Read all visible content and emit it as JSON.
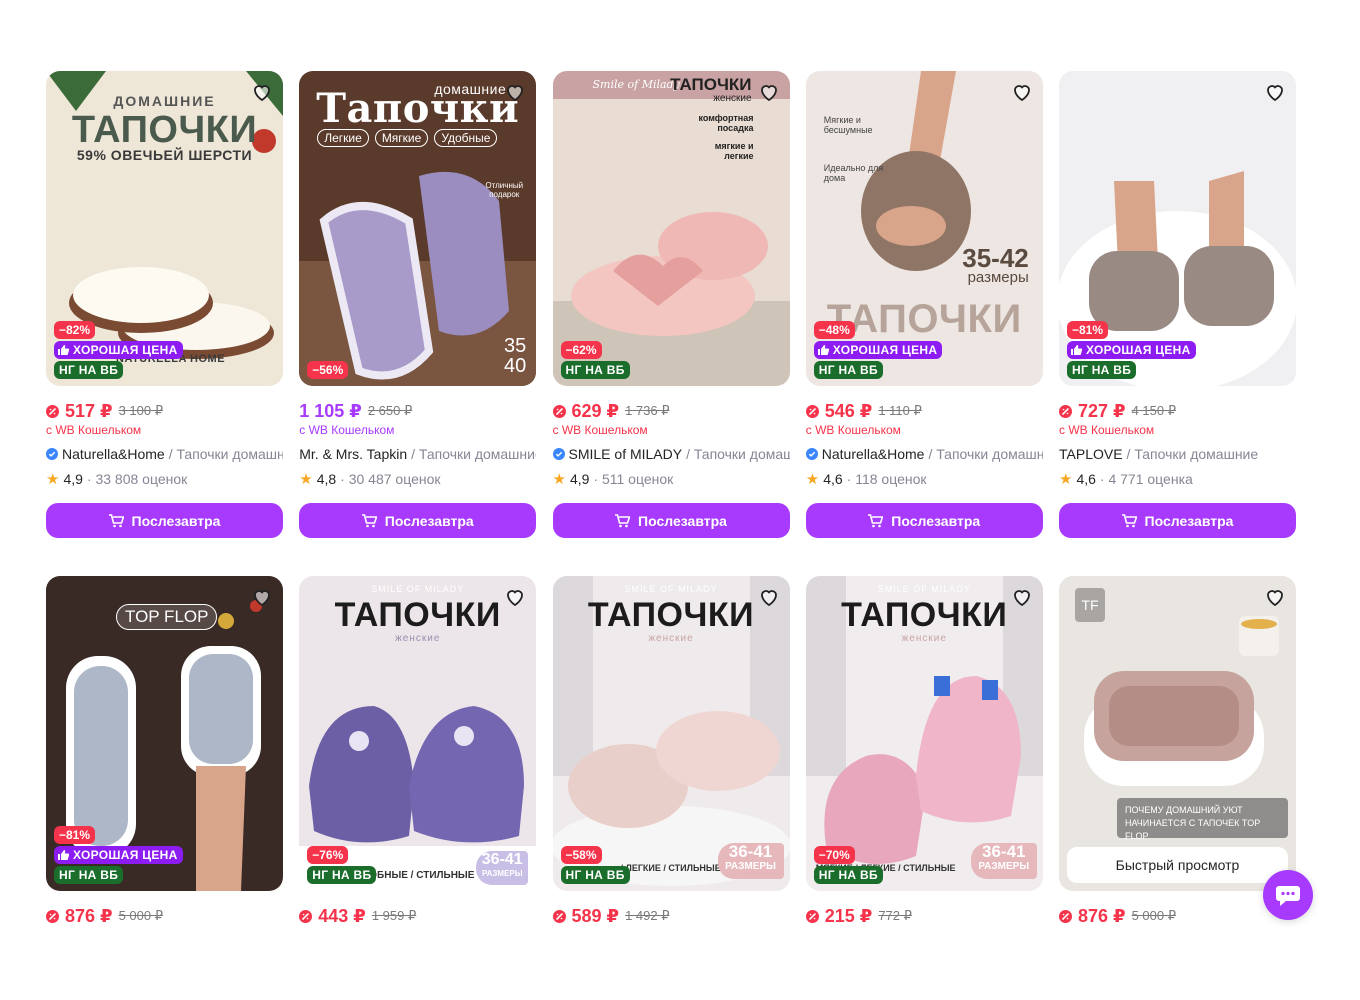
{
  "colors": {
    "accent": "#a73afd",
    "sale": "#f5334a",
    "good_price": "#8d1cf2",
    "ng_badge": "#1a6d2a"
  },
  "products": [
    {
      "image_text": {
        "line1": "ДОМАШНИЕ",
        "line2": "ТАПОЧКИ",
        "line3": "59% ОВЕЧЬЕЙ ШЕРСТИ",
        "brand": "NATURELLA HOME"
      },
      "discount": "−82%",
      "good_price": "ХОРОШАЯ ЦЕНА",
      "ng": "НГ НА ВБ",
      "price": "517 ₽",
      "old_price": "3 100 ₽",
      "wallet": "с WB Кошельком",
      "brand": "Naturella&Home",
      "product": " / Тапочки домашние",
      "verified": true,
      "rating": "4,9",
      "reviews": "· 33 808 оценок",
      "button": "Послезавтра"
    },
    {
      "image_text": {
        "line1": "домашние",
        "line2": "Тапочки",
        "tag1": "Легкие",
        "tag2": "Мягкие",
        "tag3": "Удобные",
        "gift": "Отличный подарок",
        "size1": "35",
        "size2": "40"
      },
      "discount": "−56%",
      "price": "1 105 ₽",
      "old_price": "2 650 ₽",
      "wallet": "с WB Кошельком",
      "brand": "Mr. & Mrs. Tapkin",
      "product": " / Тапочки домашние",
      "verified": false,
      "rating": "4,8",
      "reviews": "· 30 487 оценок",
      "button": "Послезавтра"
    },
    {
      "image_text": {
        "logo": "Smile of Milady",
        "line1": "ТАПОЧКИ",
        "line2": "женские",
        "f1": "комфортная посадка",
        "f2": "мягкие и легкие"
      },
      "discount": "−62%",
      "ng": "НГ НА ВБ",
      "price": "629 ₽",
      "old_price": "1 736 ₽",
      "wallet": "с WB Кошельком",
      "brand": "SMILE of MILADY",
      "product": " / Тапочки домашние",
      "verified": true,
      "rating": "4,9",
      "reviews": "· 511 оценок",
      "button": "Послезавтра"
    },
    {
      "image_text": {
        "f1": "Мягкие и бесшумные",
        "f2": "Идеально для дома",
        "size": "35-42",
        "size_label": "размеры",
        "title": "ТАПОЧКИ"
      },
      "discount": "−48%",
      "good_price": "ХОРОШАЯ ЦЕНА",
      "ng": "НГ НА ВБ",
      "price": "546 ₽",
      "old_price": "1 110 ₽",
      "wallet": "с WB Кошельком",
      "brand": "Naturella&Home",
      "product": " / Тапочки домашние",
      "verified": true,
      "rating": "4,6",
      "reviews": "· 118 оценок",
      "button": "Послезавтра"
    },
    {
      "image_text": {},
      "discount": "−81%",
      "good_price": "ХОРОШАЯ ЦЕНА",
      "ng": "НГ НА ВБ",
      "price": "727 ₽",
      "old_price": "4 150 ₽",
      "wallet": "с WB Кошельком",
      "brand": "TAPLOVE",
      "product": " / Тапочки домашние",
      "verified": false,
      "rating": "4,6",
      "reviews": "· 4 771 оценка",
      "button": "Послезавтра"
    },
    {
      "image_text": {
        "logo": "TOP FLOP"
      },
      "discount": "−81%",
      "good_price": "ХОРОШАЯ ЦЕНА",
      "ng": "НГ НА ВБ",
      "price": "876 ₽",
      "old_price": "5 000 ₽"
    },
    {
      "image_text": {
        "logo": "SMILE OF MILADY",
        "title": "ТАПОЧКИ",
        "sub": "женские",
        "bottom": "ОБНЫЕ / СТИЛЬНЫЕ",
        "size": "36-41",
        "size_label": "РАЗМЕРЫ"
      },
      "discount": "−76%",
      "ng": "НГ НА ВБ",
      "price": "443 ₽",
      "old_price": "1 959 ₽"
    },
    {
      "image_text": {
        "logo": "SMILE OF MILADY",
        "title": "ТАПОЧКИ",
        "sub": "женские",
        "bottom": "/ ЛЕГКИЕ / СТИЛЬНЫЕ",
        "size": "36-41",
        "size_label": "РАЗМЕРЫ"
      },
      "discount": "−58%",
      "ng": "НГ НА ВБ",
      "price": "589 ₽",
      "old_price": "1 492 ₽"
    },
    {
      "image_text": {
        "logo": "SMILE OF MILADY",
        "title": "ТАПОЧКИ",
        "sub": "женские",
        "bottom": "МЯГКИЕ / ЛЕГКИЕ / СТИЛЬНЫЕ",
        "size": "36-41",
        "size_label": "РАЗМЕРЫ"
      },
      "discount": "−70%",
      "ng": "НГ НА ВБ",
      "price": "215 ₽",
      "old_price": "772 ₽"
    },
    {
      "image_text": {
        "logo": "TF",
        "caption": "ПОЧЕМУ ДОМАШНИЙ УЮТ НАЧИНАЕТСЯ С ТАПОЧЕК TOP FLOP"
      },
      "quick_view": "Быстрый просмотр",
      "price": "876 ₽",
      "old_price": "5 000 ₽"
    }
  ]
}
